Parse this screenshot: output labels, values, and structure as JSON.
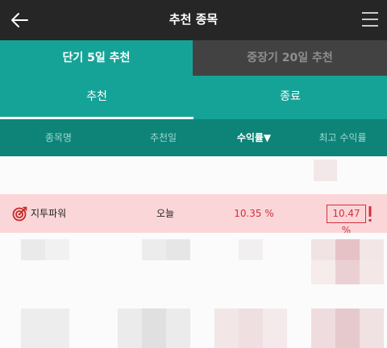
{
  "header": {
    "title": "추천 종목",
    "back_icon": "arrow-left-icon",
    "menu_icon": "hamburger-menu-icon"
  },
  "period_tabs": [
    {
      "label": "단기 5일 추천",
      "active": true
    },
    {
      "label": "중장기 20일 추천",
      "active": false
    }
  ],
  "status_tabs": [
    {
      "label": "추천",
      "active": true
    },
    {
      "label": "종료",
      "active": false
    }
  ],
  "columns": {
    "name": "종목명",
    "date": "추천일",
    "return": "수익률▼",
    "max_return": "최고 수익률"
  },
  "highlighted_row": {
    "name": "지투파워",
    "date": "오늘",
    "return": "10.35 %",
    "max_return": "10.47 %",
    "icon": "target-icon"
  },
  "colors": {
    "header_bg": "#262626",
    "teal": "#16a397",
    "teal_dark": "#0e8378",
    "tab_inactive": "#424242",
    "highlight_bg": "#fbd6d8",
    "positive_red": "#d32f3c"
  }
}
